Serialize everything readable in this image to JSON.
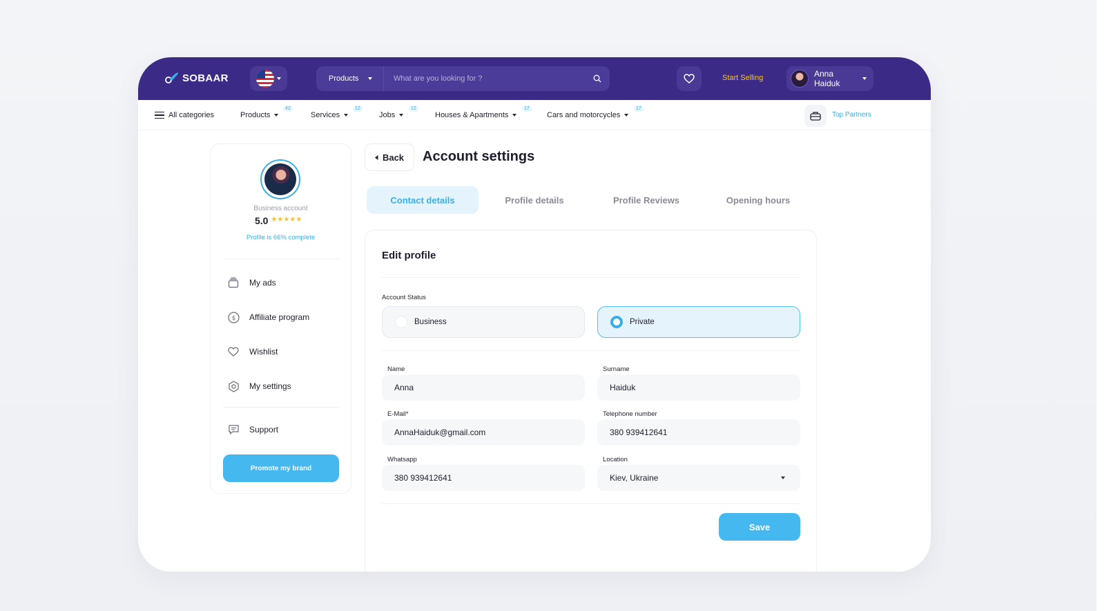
{
  "brand": {
    "name": "SOBAAR"
  },
  "header": {
    "search": {
      "category": "Products",
      "placeholder": "What are you looking for ?"
    },
    "start_selling": "Start Selling",
    "user_name": "Anna Haiduk"
  },
  "categories": {
    "all_label": "All categories",
    "items": [
      {
        "label": "Products",
        "count": "42"
      },
      {
        "label": "Services",
        "count": "12"
      },
      {
        "label": "Jobs",
        "count": "12"
      },
      {
        "label": "Houses & Apartments",
        "count": "17"
      },
      {
        "label": "Cars and motorcycles",
        "count": "17"
      }
    ],
    "top_partners": "Top Partners"
  },
  "sidebar": {
    "account_type": "Business account",
    "rating": "5.0",
    "stars": "★★★★★",
    "complete": "Profile is 66% complete",
    "items": [
      {
        "label": "My ads",
        "icon": "ads-icon"
      },
      {
        "label": "Affiliate program",
        "icon": "dollar-icon"
      },
      {
        "label": "Wishlist",
        "icon": "heart-icon"
      },
      {
        "label": "My settings",
        "icon": "settings-icon"
      },
      {
        "label": "Support",
        "icon": "chat-icon"
      }
    ],
    "promote_label": "Promote my brand"
  },
  "main": {
    "back_label": "Back",
    "title": "Account settings",
    "tabs": [
      {
        "label": "Contact details",
        "active": true
      },
      {
        "label": "Profile details",
        "active": false
      },
      {
        "label": "Profile Reviews",
        "active": false
      },
      {
        "label": "Opening hours",
        "active": false
      }
    ]
  },
  "form": {
    "title": "Edit profile",
    "status_label": "Account Status",
    "status_options": [
      {
        "label": "Business",
        "selected": false
      },
      {
        "label": "Private",
        "selected": true
      }
    ],
    "fields": {
      "name": {
        "label": "Name",
        "value": "Anna"
      },
      "surname": {
        "label": "Surname",
        "value": "Haiduk"
      },
      "email": {
        "label": "E-Mail*",
        "value": "AnnaHaiduk@gmail.com"
      },
      "phone": {
        "label": "Telephone number",
        "value": "380 939412641"
      },
      "whatsapp": {
        "label": "Whatsapp",
        "value": "380 939412641"
      },
      "location": {
        "label": "Location",
        "value": "Kiev, Ukraine"
      }
    },
    "save_label": "Save"
  },
  "colors": {
    "header": "#3b2b87",
    "accent": "#44b8ef",
    "highlight": "#f6c12a"
  }
}
